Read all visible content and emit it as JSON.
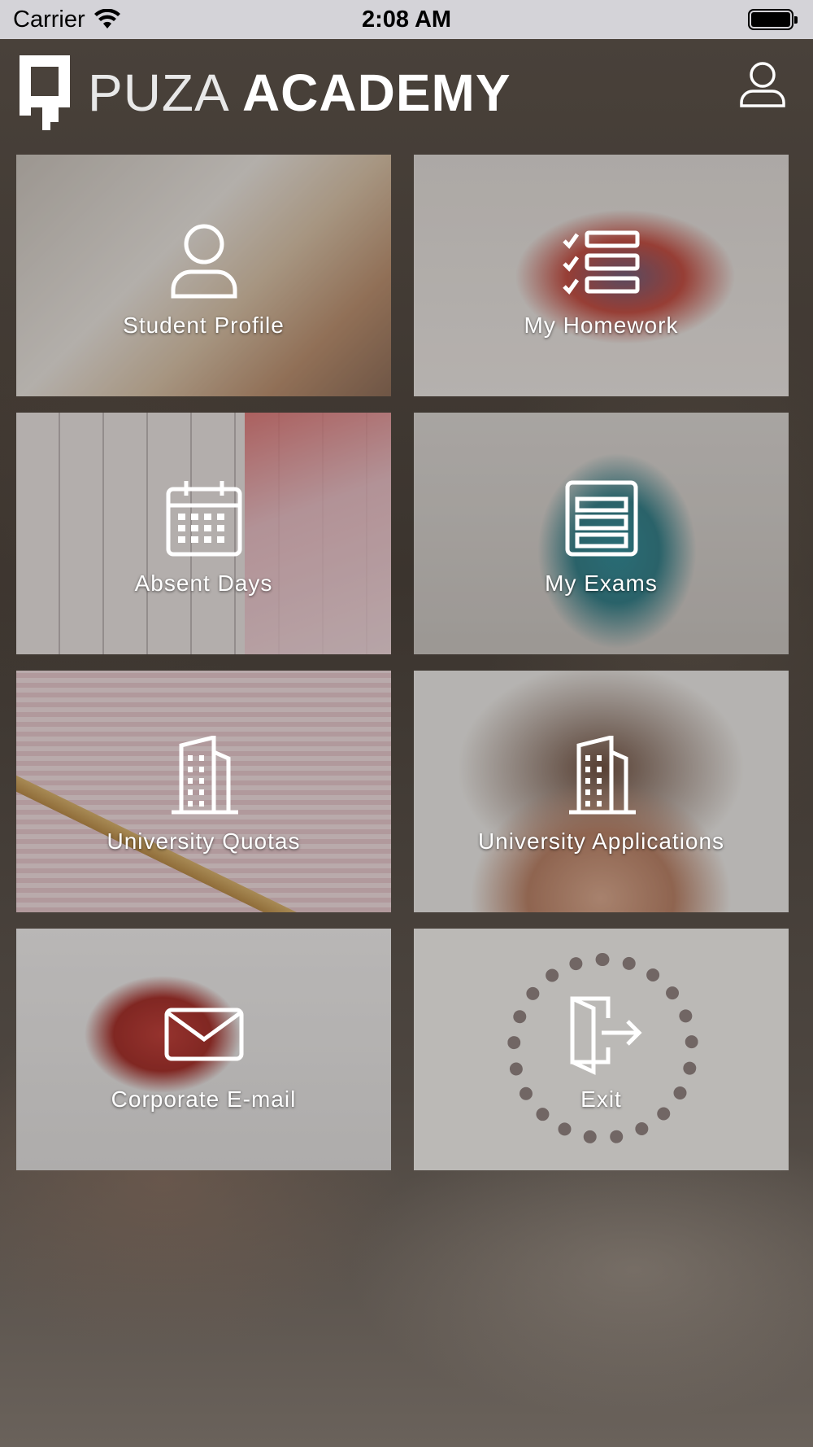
{
  "status_bar": {
    "carrier": "Carrier",
    "time": "2:08 AM"
  },
  "header": {
    "logo_light": "PUZA",
    "logo_bold": "ACADEMY"
  },
  "tiles": [
    {
      "label": "Student Profile",
      "icon": "person-icon"
    },
    {
      "label": "My Homework",
      "icon": "checklist-icon"
    },
    {
      "label": "Absent Days",
      "icon": "calendar-icon"
    },
    {
      "label": "My Exams",
      "icon": "exam-sheet-icon"
    },
    {
      "label": "University Quotas",
      "icon": "building-icon"
    },
    {
      "label": "University Applications",
      "icon": "building-icon"
    },
    {
      "label": "Corporate E-mail",
      "icon": "envelope-icon"
    },
    {
      "label": "Exit",
      "icon": "exit-door-icon"
    }
  ],
  "colors": {
    "status_bar_bg": "#d4d3d8",
    "tile_text": "#ffffff",
    "background": "#3a332d"
  }
}
